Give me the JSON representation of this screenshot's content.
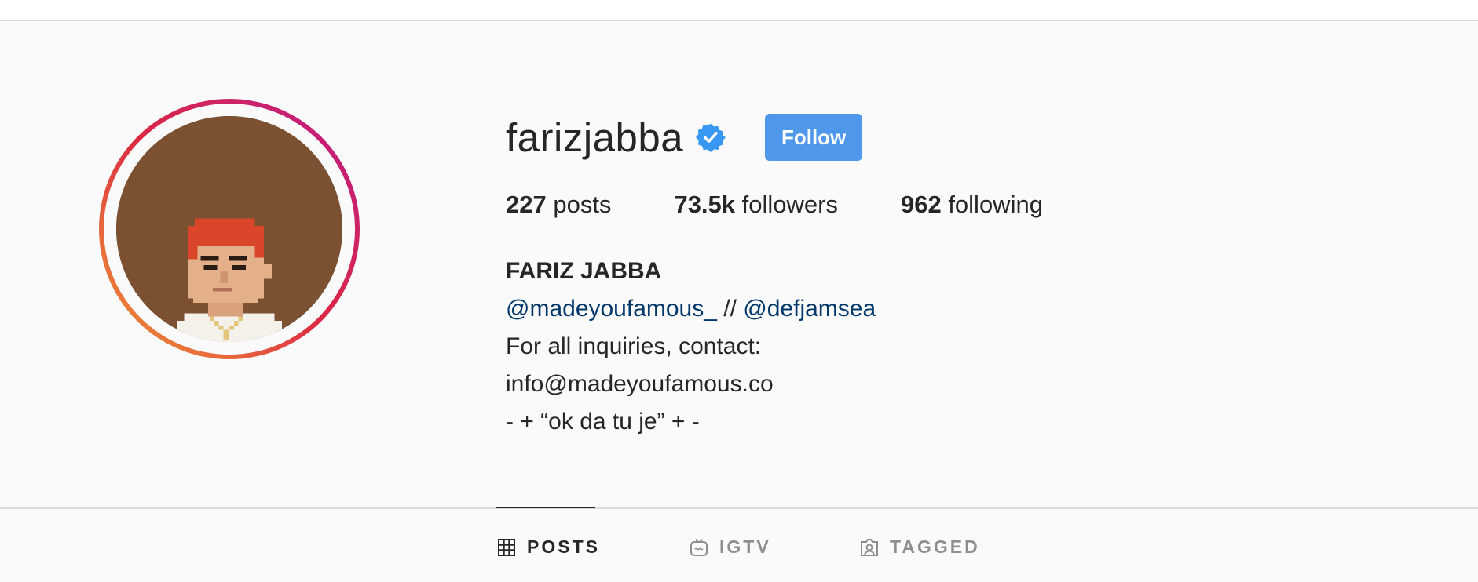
{
  "profile": {
    "username": "farizjabba",
    "verified": true,
    "follow_label": "Follow",
    "accent_color": "#4e97ea"
  },
  "stats": {
    "posts_count": "227",
    "posts_label": " posts",
    "followers_count": "73.5k",
    "followers_label": " followers",
    "following_count": "962",
    "following_label": " following"
  },
  "bio": {
    "full_name": "FARIZ JABBA",
    "mention_1": "@madeyoufamous_",
    "separator": " // ",
    "mention_2": "@defjamsea",
    "line_3": "For all inquiries, contact:",
    "line_4": "info@madeyoufamous.co",
    "line_5": "- + “ok da tu je” + -"
  },
  "tabs": [
    {
      "label": "POSTS",
      "icon": "grid-icon",
      "active": true
    },
    {
      "label": "IGTV",
      "icon": "igtv-icon",
      "active": false
    },
    {
      "label": "TAGGED",
      "icon": "tagged-icon",
      "active": false
    }
  ],
  "icons": {
    "verified": "verified-badge-icon",
    "avatar": "pixel-art-avatar"
  }
}
